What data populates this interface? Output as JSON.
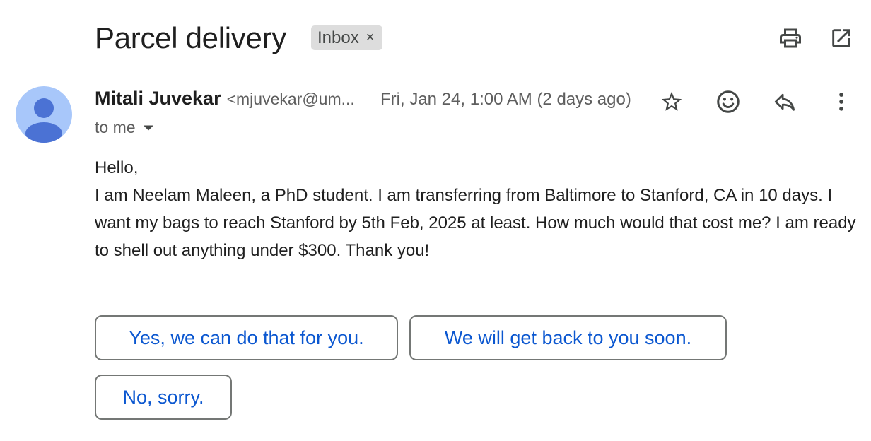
{
  "email": {
    "subject": "Parcel delivery",
    "label_chip": "Inbox",
    "label_chip_close": "×",
    "sender_name": "Mitali Juvekar",
    "sender_email": "<mjuvekar@um...",
    "date": "Fri, Jan 24, 1:00 AM (2 days ago)",
    "recipient": "to me",
    "body_greeting": "Hello,",
    "body_text": "I am Neelam Maleen, a PhD student. I am transferring from Baltimore to Stanford, CA in 10 days. I want my bags to reach Stanford by 5th Feb, 2025 at least. How much would that cost me? I am ready to shell out anything under $300. Thank you!"
  },
  "smart_replies": [
    "Yes, we can do that for you.",
    "We will get back to you soon.",
    "No, sorry."
  ],
  "icons": {
    "header": [
      "print-icon",
      "open-in-new-window-icon"
    ],
    "actions": [
      "star-icon",
      "emoji-reaction-icon",
      "reply-icon",
      "more-options-icon"
    ],
    "recipient_toggle": "chevron-down-icon",
    "avatar": "person-avatar-icon"
  },
  "colors": {
    "link_blue": "#0b57d0",
    "avatar_bg": "#a8c7fa",
    "avatar_fg": "#4b72d4",
    "chip_bg": "#dddddd"
  }
}
